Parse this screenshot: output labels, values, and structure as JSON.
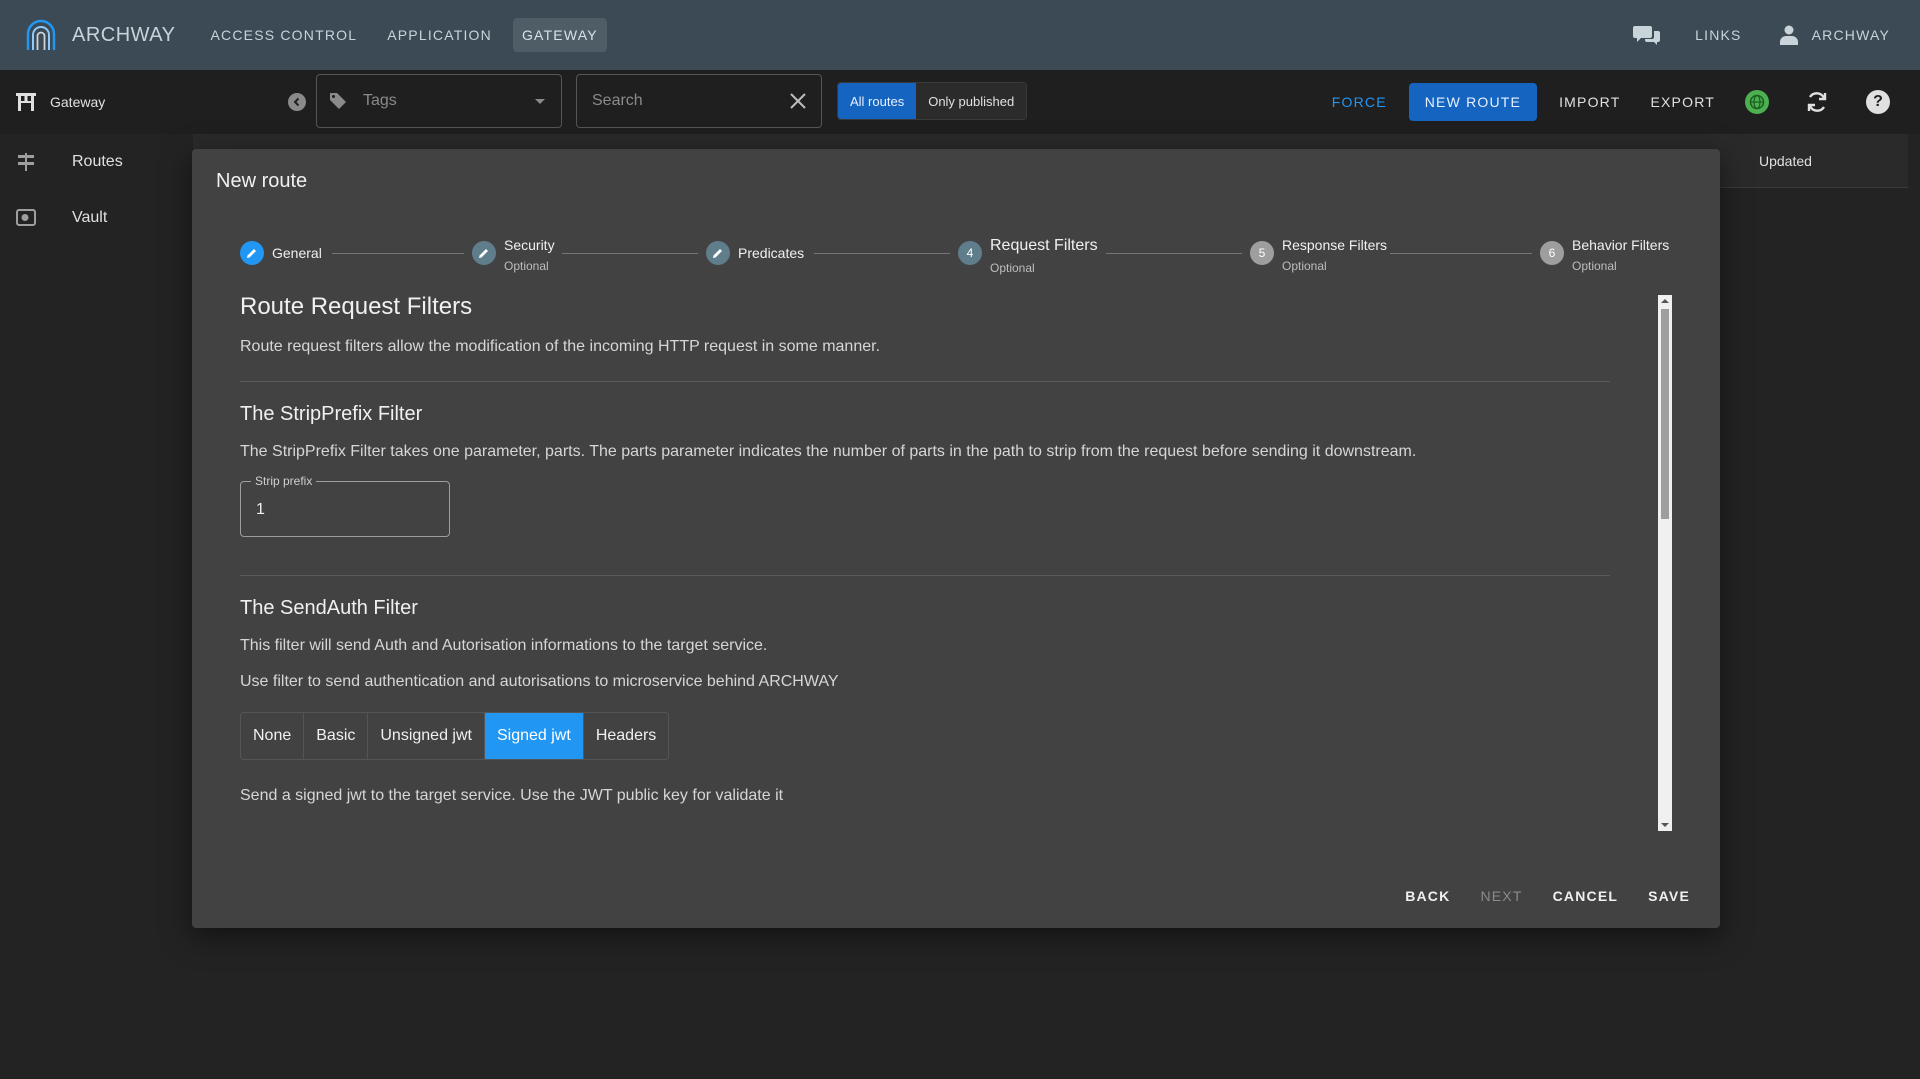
{
  "app": {
    "name": "ARCHWAY"
  },
  "topnav": {
    "items": [
      "ACCESS CONTROL",
      "APPLICATION",
      "GATEWAY"
    ],
    "active": "GATEWAY"
  },
  "appbar_right": {
    "links": "LINKS",
    "user": "ARCHWAY"
  },
  "toolbar": {
    "section": "Gateway",
    "tags_placeholder": "Tags",
    "search_placeholder": "Search",
    "filter_all": "All routes",
    "filter_published": "Only published",
    "force": "FORCE",
    "new_route": "NEW ROUTE",
    "import": "IMPORT",
    "export": "EXPORT"
  },
  "sidebar": {
    "items": [
      {
        "label": "Routes",
        "icon": "routes-icon"
      },
      {
        "label": "Vault",
        "icon": "vault-icon"
      }
    ]
  },
  "table": {
    "updated_header": "Updated"
  },
  "modal": {
    "title": "New route",
    "steps": [
      {
        "name": "General",
        "optional": ""
      },
      {
        "name": "Security",
        "optional": "Optional"
      },
      {
        "name": "Predicates",
        "optional": ""
      },
      {
        "number": "4",
        "name": "Request Filters",
        "optional": "Optional"
      },
      {
        "number": "5",
        "name": "Response Filters",
        "optional": "Optional"
      },
      {
        "number": "6",
        "name": "Behavior Filters",
        "optional": "Optional"
      }
    ],
    "heading": "Route Request Filters",
    "intro": "Route request filters allow the modification of the incoming HTTP request in some manner.",
    "strip": {
      "title": "The StripPrefix Filter",
      "desc": "The StripPrefix Filter takes one parameter, parts. The parts parameter indicates the number of parts in the path to strip from the request before sending it downstream.",
      "label": "Strip prefix",
      "value": "1"
    },
    "sendauth": {
      "title": "The SendAuth Filter",
      "desc1": "This filter will send Auth and Autorisation informations to the target service.",
      "desc2": "Use filter to send authentication and autorisations to microservice behind ARCHWAY",
      "options": [
        "None",
        "Basic",
        "Unsigned jwt",
        "Signed jwt",
        "Headers"
      ],
      "selected": "Signed jwt",
      "note": "Send a signed jwt to the target service. Use the JWT public key for validate it"
    },
    "actions": {
      "back": "BACK",
      "next": "NEXT",
      "cancel": "CANCEL",
      "save": "SAVE"
    }
  },
  "colors": {
    "accent": "#1565c0",
    "selected": "#2196f3",
    "appbar": "#3b4a54",
    "modal": "#424242",
    "status_ok": "#4caf50"
  }
}
